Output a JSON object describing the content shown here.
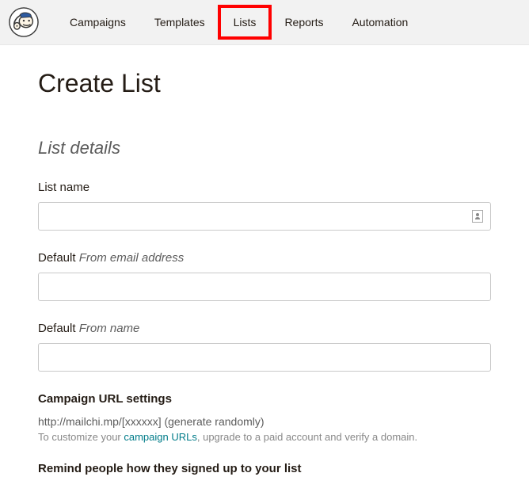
{
  "nav": {
    "items": [
      {
        "label": "Campaigns"
      },
      {
        "label": "Templates"
      },
      {
        "label": "Lists"
      },
      {
        "label": "Reports"
      },
      {
        "label": "Automation"
      }
    ]
  },
  "page": {
    "title": "Create List"
  },
  "section": {
    "title": "List details"
  },
  "fields": {
    "list_name": {
      "label": "List name",
      "value": ""
    },
    "from_email": {
      "label_prefix": "Default ",
      "label_italic": "From email address",
      "value": ""
    },
    "from_name": {
      "label_prefix": "Default ",
      "label_italic": "From name",
      "value": ""
    }
  },
  "campaign_url": {
    "heading": "Campaign URL settings",
    "url_text": "http://mailchi.mp/[xxxxxx] (generate randomly)",
    "help_prefix": "To customize your ",
    "help_link": "campaign URLs",
    "help_suffix": ", upgrade to a paid account and verify a domain."
  },
  "remind": {
    "heading": "Remind people how they signed up to your list"
  }
}
